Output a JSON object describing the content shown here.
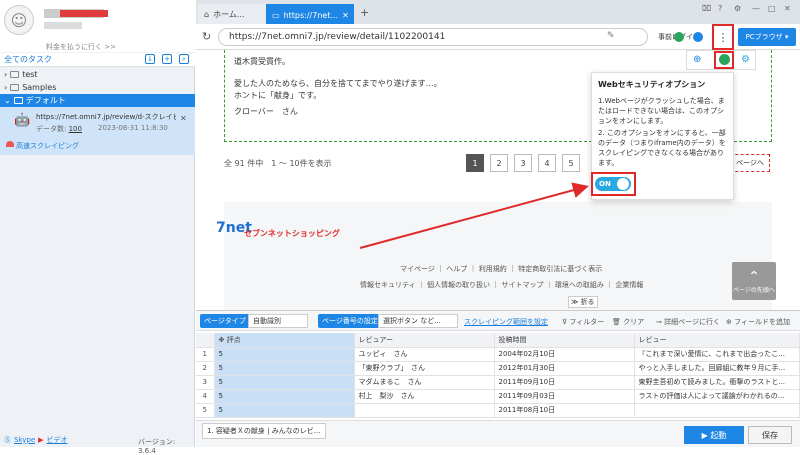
{
  "user": {
    "pay_label": "料金を払うに行く >>"
  },
  "tasks": {
    "header": "全てのタスク",
    "folders": [
      "test",
      "Samples",
      "デフォルト"
    ],
    "item": {
      "url": "https://7net.omni7.jp/review/d-スクレイピン...",
      "count_label": "データ数:",
      "count": "100",
      "date": "2023-08-31 11:8:30",
      "speed_label": "高速スクレイピング"
    }
  },
  "footer_left": {
    "skype": "Skype",
    "video": "ビデオ",
    "version": "バージョン: 3.6.4"
  },
  "browser": {
    "tabs": [
      "ホーム...",
      "https://7net..."
    ],
    "url": "https://7net.omni7.jp/review/detail/1102200141",
    "pre_login": "事前ログイン",
    "pc_browser": "PCブラウザ"
  },
  "page": {
    "lines": [
      "道木貫受貫作。",
      "愛した人のためなら、自分を捨ててまでやり遂げます…。",
      "ホントに「献身」です。",
      "クローバー　さん"
    ],
    "pager_text": "全 91 件中　1 ～ 10件を表示",
    "pages": [
      "1",
      "2",
      "3",
      "4",
      "5"
    ],
    "next_page": "ページへ",
    "logo_mark": "7net",
    "logo_text": "セブンネットショッピング",
    "links_row1": "マイページ ｜ ヘルプ ｜ 利用規約 ｜ 特定商取引法に基づく表示",
    "links_row2": "情報セキュリティ ｜ 個人情報の取り扱い ｜ サイトマップ ｜ 環境への取組み ｜ 企業情報",
    "scroll_top": "ページの先頭へ",
    "fold": "折る"
  },
  "popup": {
    "title": "Webセキュリティオプション",
    "text1": "1.Webページがクラッシュした場合、またはロードできない場合は、このオプションをオンにします。",
    "text2": "2. このオプションをオンにすると、一部のデータ（つまりiframe内のデータ）をスクレイピングできなくなる場合があります。",
    "toggle": "ON"
  },
  "data_panel": {
    "page_type_label": "ページタイプ",
    "page_type_value": "自動識別",
    "page_num_label": "ページ番号の設定",
    "page_num_value": "選択ボタン など...",
    "scrape_range": "スクレイピング範囲を設定",
    "filter": "フィルター",
    "clear": "クリア",
    "detail": "詳細ページに行く",
    "add_field": "フィールドを追加",
    "columns": [
      "評点",
      "レビュアー",
      "投稿時間",
      "レビュー"
    ],
    "rows": [
      [
        "1",
        "5",
        "ユッピィ　さん",
        "2004年02月10日",
        "『これまで深い愛情に、これまで出会ったこ..."
      ],
      [
        "2",
        "5",
        "「東野クラブ」　さん",
        "2012年01月30日",
        "やっと入手しました。回廊組に教年９月に手..."
      ],
      [
        "3",
        "5",
        "マダムまるこ　さん",
        "2011年09月10日",
        "東野圭吾初めて読みました。衝撃のラストと..."
      ],
      [
        "4",
        "5",
        "村上　梨沙　さん",
        "2011年09月03日",
        "ラストの評価は人によって議論がわかれるの..."
      ],
      [
        "5",
        "5",
        "",
        "2011年08月10日",
        ""
      ]
    ]
  },
  "bottom": {
    "tab": "1. 容疑者Ｘの献身 | みんなのレビ...",
    "start": "起動",
    "save": "保存"
  },
  "colors": {
    "accent": "#1e86e5",
    "highlight": "#e02a2a",
    "toggle": "#29a9e0"
  }
}
